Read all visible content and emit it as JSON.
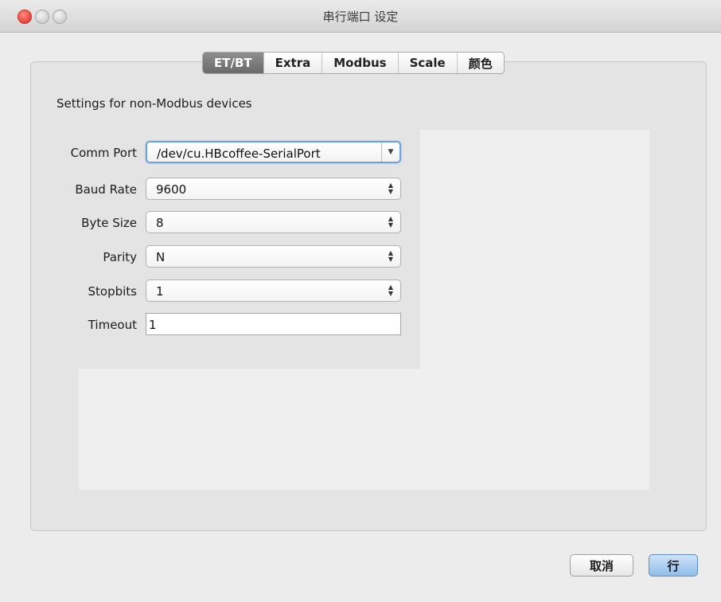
{
  "window": {
    "title": "串行端口 设定"
  },
  "tabs": [
    {
      "label": "ET/BT",
      "active": true
    },
    {
      "label": "Extra",
      "active": false
    },
    {
      "label": "Modbus",
      "active": false
    },
    {
      "label": "Scale",
      "active": false
    },
    {
      "label": "颜色",
      "active": false
    }
  ],
  "section": {
    "heading": "Settings for non-Modbus devices"
  },
  "form": {
    "comm_port": {
      "label": "Comm Port",
      "value": "/dev/cu.HBcoffee-SerialPort"
    },
    "baud_rate": {
      "label": "Baud Rate",
      "value": "9600"
    },
    "byte_size": {
      "label": "Byte Size",
      "value": "8"
    },
    "parity": {
      "label": "Parity",
      "value": "N"
    },
    "stopbits": {
      "label": "Stopbits",
      "value": "1"
    },
    "timeout": {
      "label": "Timeout",
      "value": "1"
    }
  },
  "buttons": {
    "cancel": "取消",
    "ok": "行"
  },
  "icons": {
    "dropdown": "chevron-down-icon",
    "stepper": "stepper-icon"
  },
  "colors": {
    "active_tab": "#7a7a7a",
    "default_button": "#8fbde9",
    "focus_ring": "#6ea2dc"
  }
}
